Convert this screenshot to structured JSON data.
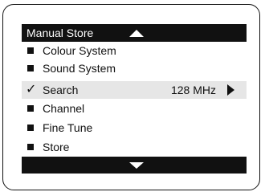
{
  "menu": {
    "title": "Manual Store",
    "items": [
      {
        "label": "Colour System",
        "marker": "bullet"
      },
      {
        "label": "Sound System",
        "marker": "bullet"
      },
      {
        "label": "Search",
        "marker": "check",
        "check_glyph": "✓",
        "value": "128 MHz",
        "selected": true
      },
      {
        "label": "Channel",
        "marker": "bullet"
      },
      {
        "label": "Fine Tune",
        "marker": "bullet"
      },
      {
        "label": "Store",
        "marker": "bullet"
      }
    ],
    "icons": {
      "scroll_up": "up-arrow-icon",
      "scroll_down": "down-arrow-icon",
      "submenu": "right-arrow-icon",
      "bullet": "square-bullet-icon",
      "check": "checkmark-icon"
    },
    "colors": {
      "bar": "#111111",
      "bar_text": "#ffffff",
      "selected_row": "#e6e6e6"
    }
  }
}
